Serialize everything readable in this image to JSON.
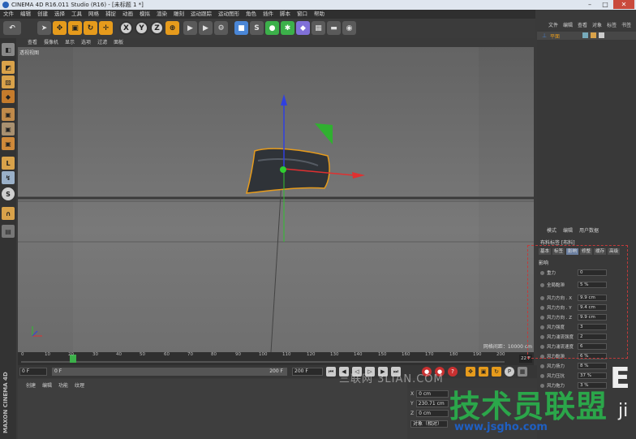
{
  "window": {
    "title": "CINEMA 4D R16.011 Studio (R16) - [未标题 1 *]"
  },
  "menu": [
    "文件",
    "编辑",
    "创建",
    "选择",
    "工具",
    "网格",
    "捕捉",
    "动画",
    "模拟",
    "渲染",
    "雕刻",
    "运动跟踪",
    "运动图形",
    "角色",
    "插件",
    "脚本",
    "窗口",
    "帮助"
  ],
  "toolbar": {
    "x": "X",
    "y": "Y",
    "z": "Z"
  },
  "viewport_menu": [
    "查看",
    "摄像机",
    "显示",
    "选项",
    "过滤",
    "面板"
  ],
  "viewport": {
    "label": "透视视图",
    "grid_info": "网格间距：10000 cm"
  },
  "timeline": {
    "ticks": [
      "0",
      "10",
      "20",
      "30",
      "40",
      "50",
      "60",
      "70",
      "80",
      "90",
      "100",
      "110",
      "120",
      "130",
      "140",
      "150",
      "160",
      "170",
      "180",
      "190",
      "200"
    ],
    "current_frame": "22 F"
  },
  "transport": {
    "start": "0 F",
    "range_start": "0 F",
    "range_end": "200 F",
    "end": "200 F"
  },
  "material_menu": [
    "创建",
    "编辑",
    "功能",
    "纹理"
  ],
  "coords": [
    {
      "axis": "X",
      "value": "0 cm"
    },
    {
      "axis": "Y",
      "value": "230.71 cm"
    },
    {
      "axis": "Z",
      "value": "0 cm"
    }
  ],
  "coord_mode": "对象（相对）",
  "right_menu": [
    "文件",
    "编辑",
    "查看",
    "对象",
    "标签",
    "书签"
  ],
  "object": {
    "name": "平面"
  },
  "attr_tabs": [
    "模式",
    "编辑",
    "用户数据"
  ],
  "attr_title": "布料标签 [布料]",
  "sub_tabs": [
    "基本",
    "标签",
    "影响",
    "修整",
    "缓存",
    "高级"
  ],
  "section_title": "影响",
  "props": [
    {
      "label": "重力",
      "value": "0"
    },
    {
      "label": "全局黏滞",
      "value": "5 %"
    },
    {
      "label": "风力方向 . X",
      "value": "9.9 cm"
    },
    {
      "label": "风力方向 . Y",
      "value": "9.4 cm"
    },
    {
      "label": "风力方向 . Z",
      "value": "9.9 cm"
    },
    {
      "label": "风力强度",
      "value": "3"
    },
    {
      "label": "风力湍流强度",
      "value": "2"
    },
    {
      "label": "风力湍流速度",
      "value": "6"
    },
    {
      "label": "风力黏滞",
      "value": "6 %"
    },
    {
      "label": "风力扬力",
      "value": "8 %"
    },
    {
      "label": "风力压抗",
      "value": "37 %"
    },
    {
      "label": "风力拖力",
      "value": "3 %"
    }
  ],
  "watermarks": {
    "w1": "三联网 3LIAN.COM",
    "w2": "技术员联盟",
    "w3": "www.jsgho.com",
    "e1": "E",
    "e2": "ji"
  },
  "colors": {
    "x_axis": "#e03030",
    "y_axis": "#3040e0",
    "z_axis": "#30c030",
    "selection": "#e69b1c",
    "watermark_green": "#2ba64a"
  }
}
